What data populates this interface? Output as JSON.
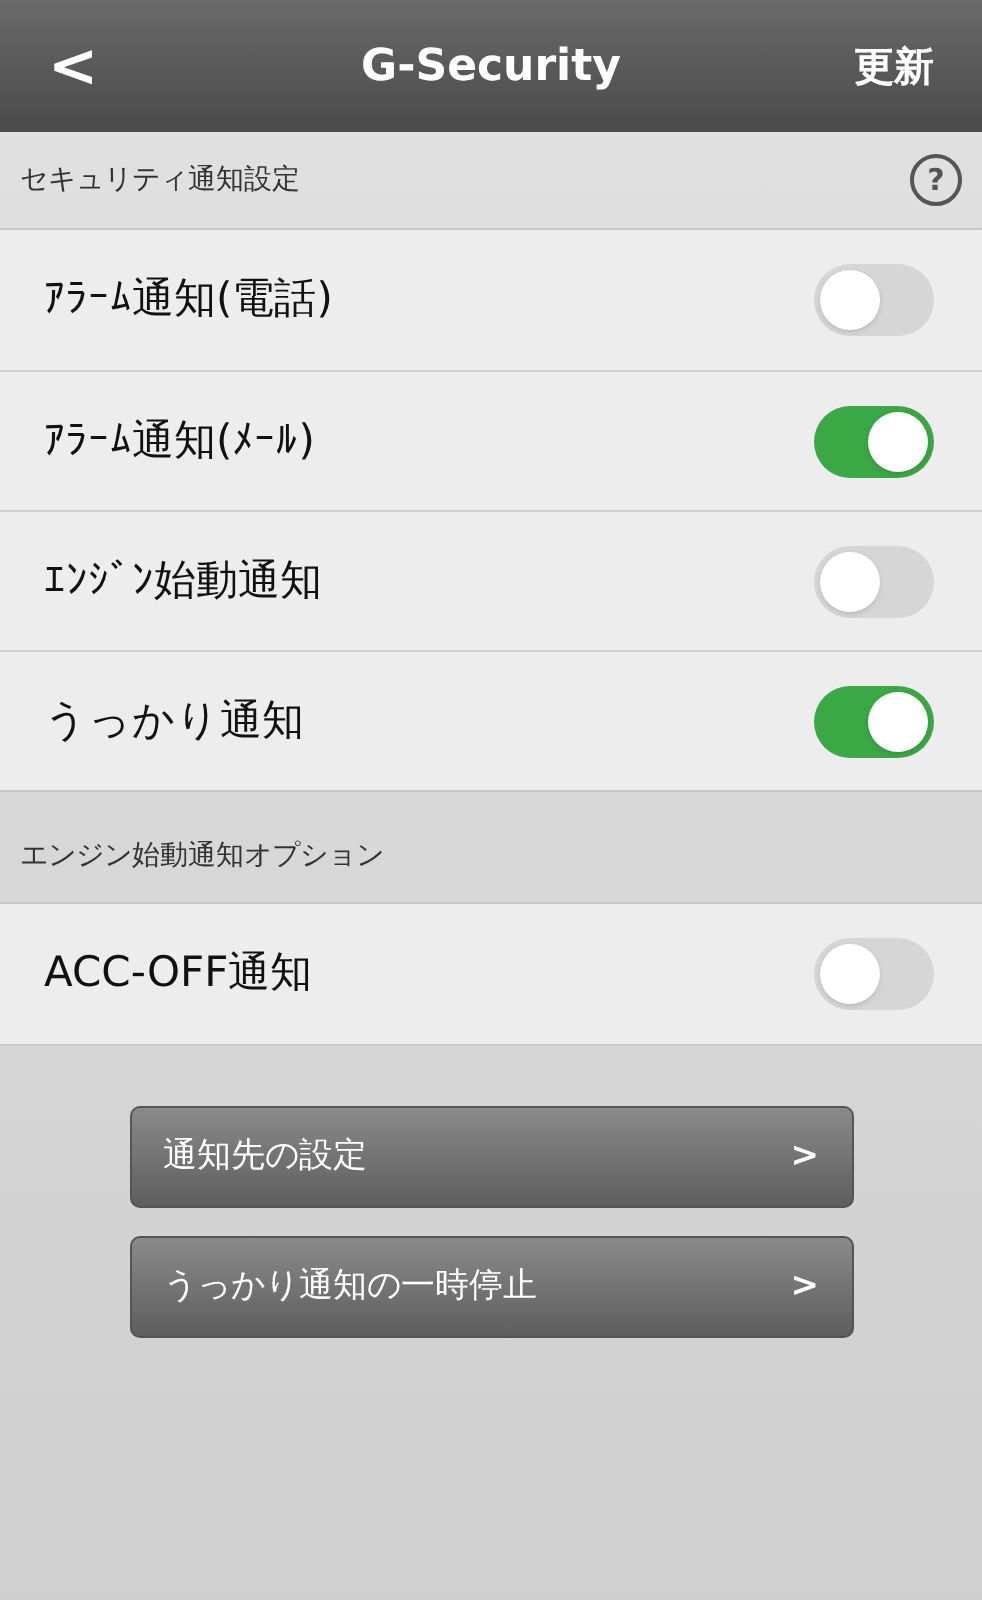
{
  "header": {
    "back": "<",
    "title": "G-Security",
    "action": "更新"
  },
  "sections": [
    {
      "title": "セキュリティ通知設定",
      "help": "?",
      "rows": [
        {
          "label": "ｱﾗｰﾑ通知(電話)",
          "on": false
        },
        {
          "label": "ｱﾗｰﾑ通知(ﾒｰﾙ)",
          "on": true
        },
        {
          "label": "ｴﾝｼﾞﾝ始動通知",
          "on": false
        },
        {
          "label": "うっかり通知",
          "on": true
        }
      ]
    },
    {
      "title": "エンジン始動通知オプション",
      "rows": [
        {
          "label": "ACC-OFF通知",
          "on": false
        }
      ]
    }
  ],
  "buttons": [
    {
      "label": "通知先の設定",
      "chevron": ">"
    },
    {
      "label": "うっかり通知の一時停止",
      "chevron": ">"
    }
  ]
}
